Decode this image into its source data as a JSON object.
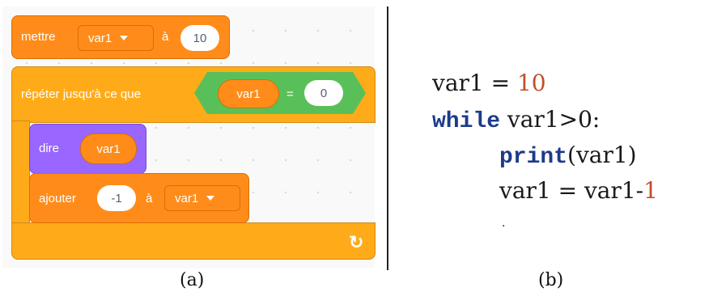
{
  "panel_a": {
    "caption": "(a)",
    "set_block": {
      "label": "mettre",
      "variable": "var1",
      "to_label": "à",
      "value": "10"
    },
    "repeat_block": {
      "label": "répéter jusqu'à ce que",
      "condition": {
        "left": "var1",
        "operator": "=",
        "right": "0"
      }
    },
    "say_block": {
      "label": "dire",
      "reporter": "var1"
    },
    "change_block": {
      "label": "ajouter",
      "value": "-1",
      "to_label": "à",
      "variable": "var1"
    },
    "loop_arrow": "↻"
  },
  "panel_b": {
    "caption": "(b)",
    "line1": {
      "var": "var1",
      "op": " = ",
      "val": "10"
    },
    "line2": {
      "kw": "while",
      "rest": " var1>0:"
    },
    "line3": {
      "kw": "print",
      "rest": "(var1)"
    },
    "line4": {
      "lhs": "var1 = var1-",
      "num": "1"
    },
    "dot": "."
  },
  "colors": {
    "events_orange": "#ff8c1a",
    "control_yellow": "#ffab19",
    "looks_purple": "#9966ff",
    "operators_green": "#59c059",
    "keyword_blue": "#1d3b8b",
    "number_red": "#c0502b"
  }
}
